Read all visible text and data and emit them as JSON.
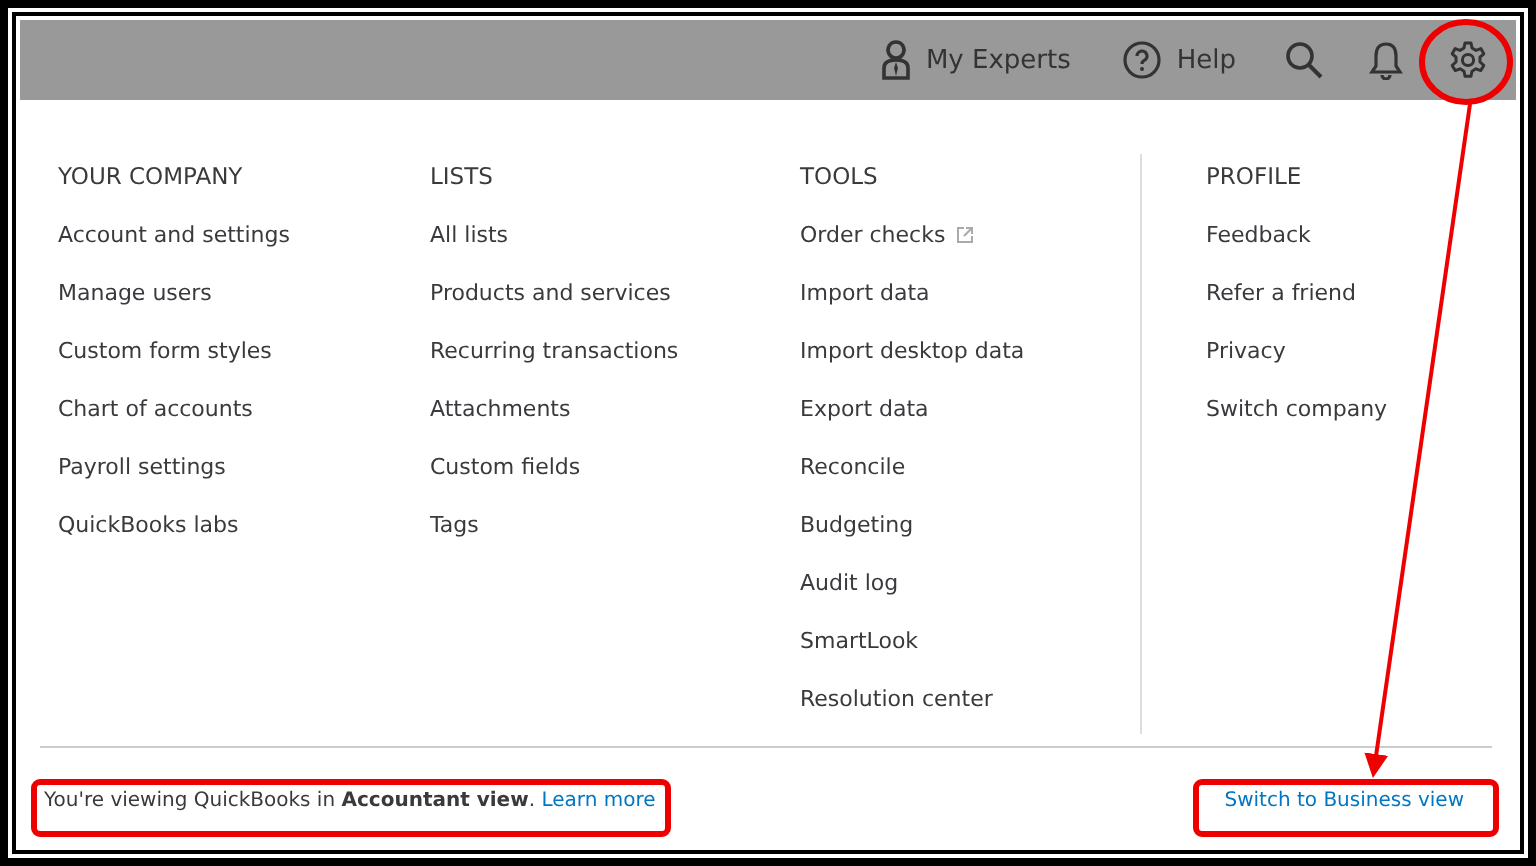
{
  "topbar": [
    {
      "kind": "experts",
      "label": "My Experts"
    },
    {
      "kind": "help",
      "label": "Help"
    },
    {
      "kind": "search"
    },
    {
      "kind": "notifications"
    },
    {
      "kind": "settings"
    }
  ],
  "columns": [
    {
      "heading": "YOUR COMPANY",
      "items": [
        {
          "label": "Account and settings",
          "kind": "link"
        },
        {
          "label": "Manage users",
          "kind": "link"
        },
        {
          "label": "Custom form styles",
          "kind": "link"
        },
        {
          "label": "Chart of accounts",
          "kind": "link"
        },
        {
          "label": "Payroll settings",
          "kind": "link"
        },
        {
          "label": "QuickBooks labs",
          "kind": "link"
        }
      ]
    },
    {
      "heading": "LISTS",
      "items": [
        {
          "label": "All lists",
          "kind": "link"
        },
        {
          "label": "Products and services",
          "kind": "link"
        },
        {
          "label": "Recurring transactions",
          "kind": "link"
        },
        {
          "label": "Attachments",
          "kind": "link"
        },
        {
          "label": "Custom fields",
          "kind": "link"
        },
        {
          "label": "Tags",
          "kind": "link"
        }
      ]
    },
    {
      "heading": "TOOLS",
      "items": [
        {
          "label": "Order checks",
          "kind": "external"
        },
        {
          "label": "Import data",
          "kind": "link"
        },
        {
          "label": "Import desktop data",
          "kind": "link"
        },
        {
          "label": "Export data",
          "kind": "link"
        },
        {
          "label": "Reconcile",
          "kind": "link"
        },
        {
          "label": "Budgeting",
          "kind": "link"
        },
        {
          "label": "Audit log",
          "kind": "link"
        },
        {
          "label": "SmartLook",
          "kind": "link"
        },
        {
          "label": "Resolution center",
          "kind": "link"
        }
      ]
    },
    {
      "heading": "PROFILE",
      "items": [
        {
          "label": "Feedback",
          "kind": "link"
        },
        {
          "label": "Refer a friend",
          "kind": "link"
        },
        {
          "label": "Privacy",
          "kind": "link"
        },
        {
          "label": "Switch company",
          "kind": "link"
        }
      ]
    }
  ],
  "footer": {
    "message": "You're viewing QuickBooks in **Accountant view**.",
    "link": "Learn more",
    "switch_link": "Switch to Business view"
  }
}
